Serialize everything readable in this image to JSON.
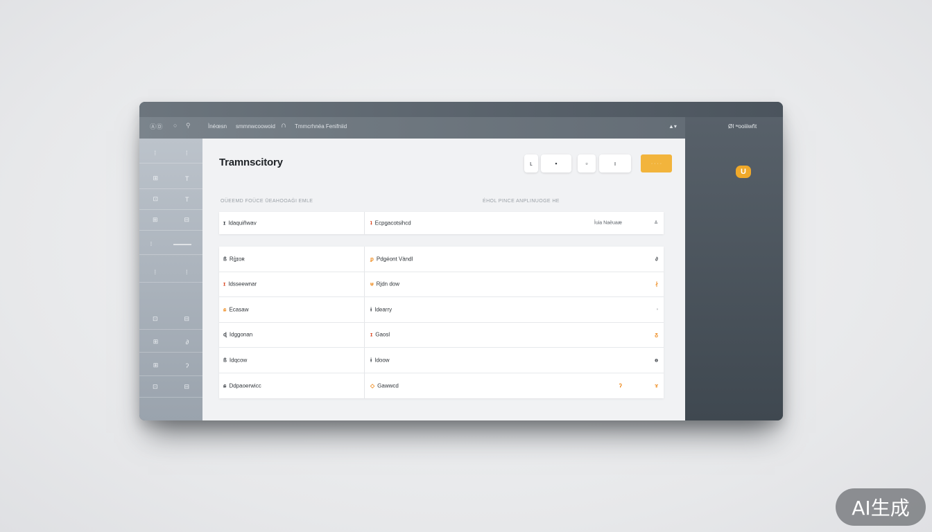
{
  "window": {
    "logo": "ⒶⒹ",
    "controls": [
      "○",
      "⚲"
    ]
  },
  "titlebar": {
    "crumb_1": "Ìnéœsn",
    "crumb_2": "smmnwcoowoid",
    "crumb_3": "Tmmcrhnéa Fenifniid",
    "user_menu": "▲▾"
  },
  "right_panel": {
    "title": "ØI ʷooiiiwñt",
    "badge": "U"
  },
  "sidebar": {
    "items": [
      {
        "icon": "⁞",
        "glyph": "⁞"
      },
      {
        "icon": "⊞",
        "glyph": "T"
      },
      {
        "icon": "⊡",
        "glyph": "T"
      },
      {
        "icon": "⊞",
        "glyph": "⊟"
      },
      {
        "icon": "⁝",
        "glyph": "⁝"
      },
      {
        "icon": "⁞",
        "glyph": "⁞"
      },
      {
        "icon": "⊡",
        "glyph": "⊟"
      },
      {
        "icon": "⊞",
        "glyph": "∂"
      },
      {
        "icon": "⊞",
        "glyph": "ʔ"
      },
      {
        "icon": "⊡",
        "glyph": "⊟"
      }
    ]
  },
  "main": {
    "title": "Tramnscitory",
    "toolbar": {
      "btn1": "ʟ",
      "btn2": "▪",
      "btn3": "▫",
      "btn4": "ı",
      "primary": "· · · ·"
    },
    "col_head_left": "OÜEEMD FOÜCE ŪEAHOOAĠI EMLE",
    "col_head_right": "ĖHOL PINCE ANPLINUOGE HE",
    "header_row": {
      "c1_mark": "ɪ",
      "c1": "Idaquiñwav",
      "c2_mark": "ʇ",
      "c2": "Ecpgacotsihcd",
      "c3b": "Ìuia Naèuaæ",
      "c3": "≜"
    },
    "rows": [
      {
        "c1_mark": "ß",
        "c1": "Rģɪoʀ",
        "c2_mark": "ᵱ",
        "c2": "Pdgéont Vàndl",
        "c3": "∂"
      },
      {
        "c1_mark": "ɪ",
        "c1": "Idsseewnar",
        "c2_mark": "ᵾ",
        "c2": "Rjdn dow",
        "c3": "∤"
      },
      {
        "c1_mark": "ɕ",
        "c1": "Ecasaw",
        "c2_mark": "ɨ",
        "c2": "Idearry",
        "c3": "◦"
      },
      {
        "c1_mark": "ɖ",
        "c1": "Idggonan",
        "c2_mark": "ɪ",
        "c2": "Gaosl",
        "c3": "ᵹ"
      },
      {
        "c1_mark": "ß",
        "c1": "Idqcow",
        "c2_mark": "ɨ",
        "c2": "Idoow",
        "c3": "ɵ"
      },
      {
        "c1_mark": "ɕ",
        "c1": "Ddpaoerwicc",
        "c2_mark": "◇",
        "c2": "Gawwcd",
        "c3b": "ʔ",
        "c3": "ɤ"
      }
    ]
  },
  "watermark": "AI生成",
  "colors": {
    "accent": "#f2b43c",
    "badge": "#f0a92a",
    "window_dark": "#4e5862"
  }
}
